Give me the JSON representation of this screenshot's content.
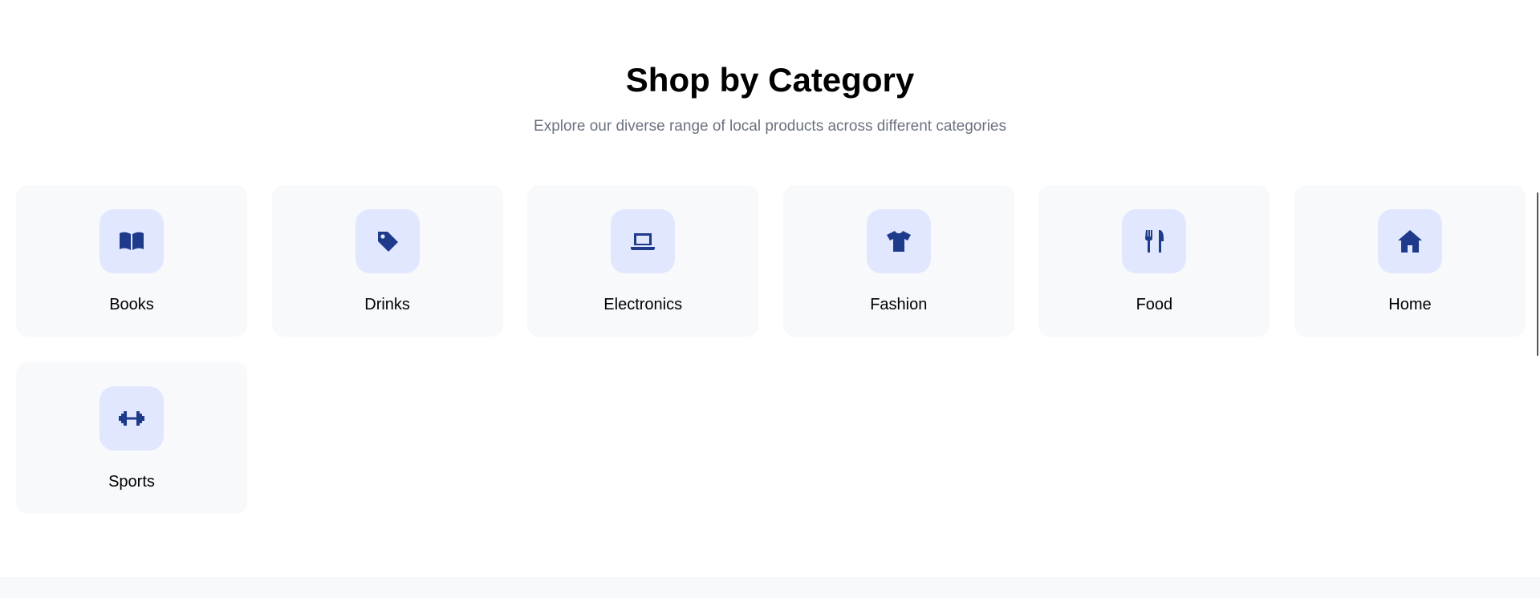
{
  "section": {
    "title": "Shop by Category",
    "subtitle": "Explore our diverse range of local products across different categories"
  },
  "categories": [
    {
      "label": "Books",
      "icon": "book-icon"
    },
    {
      "label": "Drinks",
      "icon": "tag-icon"
    },
    {
      "label": "Electronics",
      "icon": "laptop-icon"
    },
    {
      "label": "Fashion",
      "icon": "shirt-icon"
    },
    {
      "label": "Food",
      "icon": "utensils-icon"
    },
    {
      "label": "Home",
      "icon": "house-icon"
    },
    {
      "label": "Sports",
      "icon": "dumbbell-icon"
    }
  ],
  "colors": {
    "icon": "#1e3a8a",
    "icon_bg": "#e0e7ff",
    "card_bg": "#f8f9fb",
    "subtitle": "#6b7280"
  }
}
